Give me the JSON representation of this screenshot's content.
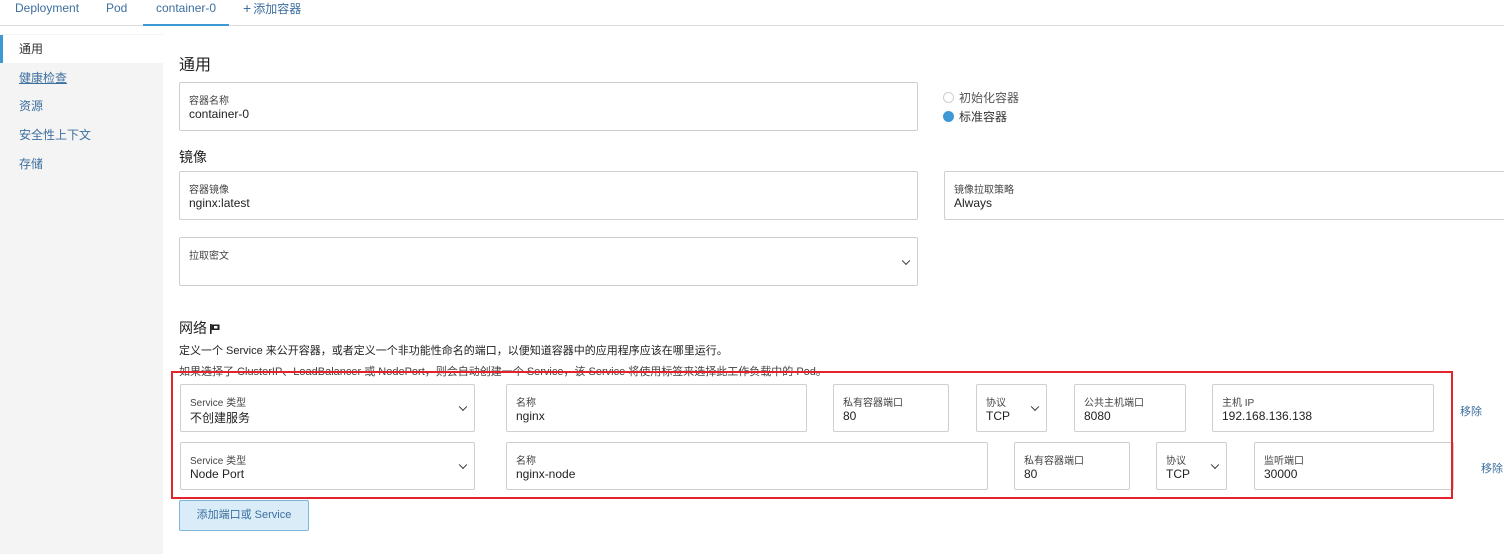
{
  "tabs": [
    {
      "label": "Deployment"
    },
    {
      "label": "Pod"
    },
    {
      "label": "container-0"
    },
    {
      "label": "添加容器",
      "icon": "plus-icon"
    }
  ],
  "sidebar": {
    "items": [
      {
        "label": "通用"
      },
      {
        "label": "健康检查"
      },
      {
        "label": "资源"
      },
      {
        "label": "安全性上下文"
      },
      {
        "label": "存储"
      }
    ]
  },
  "general": {
    "title": "通用",
    "container_name": {
      "label": "容器名称",
      "value": "container-0"
    },
    "container_type": {
      "init_label": "初始化容器",
      "standard_label": "标准容器",
      "selected": "标准容器"
    }
  },
  "image": {
    "title": "镜像",
    "container_image": {
      "label": "容器镜像",
      "value": "nginx:latest"
    },
    "pull_policy": {
      "label": "镜像拉取策略",
      "value": "Always"
    },
    "pull_secret": {
      "label": "拉取密文",
      "value": ""
    }
  },
  "network": {
    "title": "网络",
    "description_1": "定义一个 Service 来公开容器，或者定义一个非功能性命名的端口，以便知道容器中的应用程序应该在哪里运行。",
    "description_2": "如果选择了 ClusterIP、LoadBalancer 或 NodePort，则会自动创建一个 Service，该 Service 将使用标签来选择此工作负载中的 Pod。",
    "ports": [
      {
        "service_type_label": "Service 类型",
        "service_type": "不创建服务",
        "name_label": "名称",
        "name": "nginx",
        "private_port_label": "私有容器端口",
        "private_port": "80",
        "protocol_label": "协议",
        "protocol": "TCP",
        "public_port_label": "公共主机端口",
        "public_port": "8080",
        "host_ip_label": "主机 IP",
        "host_ip": "192.168.136.138",
        "remove_label": "移除"
      },
      {
        "service_type_label": "Service 类型",
        "service_type": "Node Port",
        "name_label": "名称",
        "name": "nginx-node",
        "private_port_label": "私有容器端口",
        "private_port": "80",
        "protocol_label": "协议",
        "protocol": "TCP",
        "listen_port_label": "监听端口",
        "listen_port": "30000",
        "remove_label": "移除"
      }
    ],
    "add_button": "添加端口或 Service"
  },
  "colors": {
    "accent": "#3d98d3",
    "link": "#3d6f9f",
    "highlight_box": "#e3232c"
  }
}
